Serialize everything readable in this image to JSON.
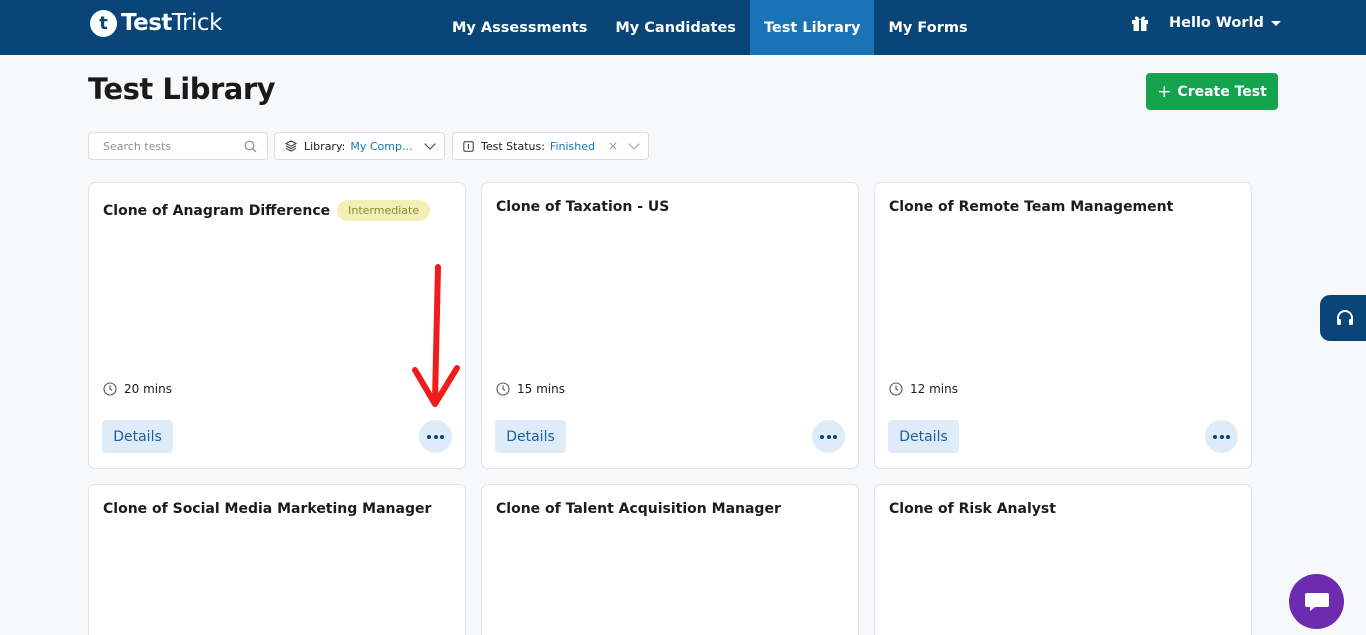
{
  "nav": {
    "logo_initial": "t",
    "logo_bold": "Test",
    "logo_light": "Trick",
    "links": [
      "My Assessments",
      "My Candidates",
      "Test Library",
      "My Forms"
    ],
    "active": "Test Library",
    "user": "Hello World"
  },
  "page": {
    "title": "Test Library",
    "create_button": "Create Test",
    "create_plus": "+"
  },
  "filters": {
    "search_placeholder": "Search tests",
    "library_label": "Library:",
    "library_value": "My Comp...",
    "status_label": "Test Status:",
    "status_value": "Finished",
    "clear": "×"
  },
  "cards": [
    {
      "title": "Clone of Anagram Difference",
      "badge": "Intermediate",
      "duration": "20 mins",
      "details": "Details"
    },
    {
      "title": "Clone of Taxation - US",
      "duration": "15 mins",
      "details": "Details"
    },
    {
      "title": "Clone of Remote Team Management",
      "duration": "12 mins",
      "details": "Details"
    },
    {
      "title": "Clone of Social Media Marketing Manager"
    },
    {
      "title": "Clone of Talent Acquisition Manager"
    },
    {
      "title": "Clone of Risk Analyst"
    }
  ],
  "colors": {
    "nav_bg": "#0a4577",
    "nav_active": "#1a73b4",
    "create_green": "#14a44d",
    "badge_bg": "#f3efb7",
    "annotation_arrow": "#f01c1c",
    "chat_purple": "#6d2bb0"
  },
  "icons": {
    "gift": "gift-icon",
    "search": "search-icon",
    "layers": "layers-icon",
    "status": "square-icon",
    "clock": "clock-icon",
    "more": "more-horizontal-icon",
    "support": "headset-icon",
    "chat": "chat-bubble-icon"
  }
}
